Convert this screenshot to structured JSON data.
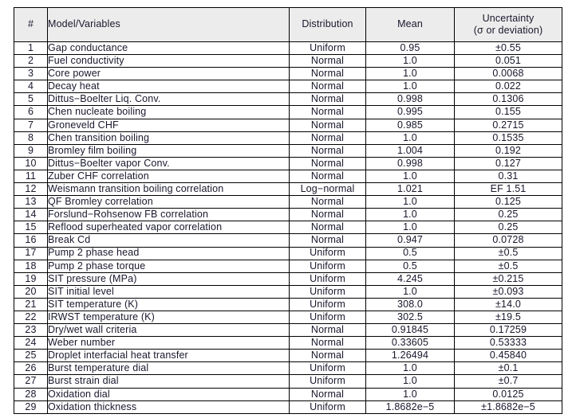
{
  "table": {
    "headers": {
      "number": "#",
      "model": "Model/Variables",
      "distribution": "Distribution",
      "mean": "Mean",
      "uncertainty_line1": "Uncertainty",
      "uncertainty_line2": "(σ or deviation)"
    },
    "colors": {
      "header_background": "#ececec",
      "border": "#000000",
      "text": "#18182c",
      "page_background": "#ffffff"
    },
    "rows": [
      {
        "num": "1",
        "model": "Gap conductance",
        "dist": "Uniform",
        "mean": "0.95",
        "unc": "±0.55"
      },
      {
        "num": "2",
        "model": "Fuel conductivity",
        "dist": "Normal",
        "mean": "1.0",
        "unc": "0.051"
      },
      {
        "num": "3",
        "model": "Core power",
        "dist": "Normal",
        "mean": "1.0",
        "unc": "0.0068"
      },
      {
        "num": "4",
        "model": "Decay heat",
        "dist": "Normal",
        "mean": "1.0",
        "unc": "0.022"
      },
      {
        "num": "5",
        "model": "Dittus−Boelter Liq. Conv.",
        "dist": "Normal",
        "mean": "0.998",
        "unc": "0.1306"
      },
      {
        "num": "6",
        "model": "Chen nucleate boiling",
        "dist": "Normal",
        "mean": "0.995",
        "unc": "0.155"
      },
      {
        "num": "7",
        "model": "Groneveld CHF",
        "dist": "Normal",
        "mean": "0.985",
        "unc": "0.2715"
      },
      {
        "num": "8",
        "model": "Chen transition boiling",
        "dist": "Normal",
        "mean": "1.0",
        "unc": "0.1535"
      },
      {
        "num": "9",
        "model": "Bromley film boiling",
        "dist": "Normal",
        "mean": "1.004",
        "unc": "0.192"
      },
      {
        "num": "10",
        "model": "Dittus−Boelter vapor Conv.",
        "dist": "Normal",
        "mean": "0.998",
        "unc": "0.127"
      },
      {
        "num": "11",
        "model": "Zuber CHF correlation",
        "dist": "Normal",
        "mean": "1.0",
        "unc": "0.31"
      },
      {
        "num": "12",
        "model": "Weismann transition boiling correlation",
        "dist": "Log−normal",
        "mean": "1.021",
        "unc": "EF 1.51"
      },
      {
        "num": "13",
        "model": "QF Bromley correlation",
        "dist": "Normal",
        "mean": "1.0",
        "unc": "0.125"
      },
      {
        "num": "14",
        "model": "Forslund−Rohsenow FB correlation",
        "dist": "Normal",
        "mean": "1.0",
        "unc": "0.25"
      },
      {
        "num": "15",
        "model": "Reflood superheated vapor correlation",
        "dist": "Normal",
        "mean": "1.0",
        "unc": "0.25"
      },
      {
        "num": "16",
        "model": "Break Cd",
        "dist": "Normal",
        "mean": "0.947",
        "unc": "0.0728"
      },
      {
        "num": "17",
        "model": "Pump 2 phase head",
        "dist": "Uniform",
        "mean": "0.5",
        "unc": "±0.5"
      },
      {
        "num": "18",
        "model": "Pump 2 phase torque",
        "dist": "Uniform",
        "mean": "0.5",
        "unc": "±0.5"
      },
      {
        "num": "19",
        "model": "SIT pressure (MPa)",
        "dist": "Uniform",
        "mean": "4.245",
        "unc": "±0.215"
      },
      {
        "num": "20",
        "model": "SIT initial level",
        "dist": "Uniform",
        "mean": "1.0",
        "unc": "±0.093"
      },
      {
        "num": "21",
        "model": "SIT temperature (K)",
        "dist": "Uniform",
        "mean": "308.0",
        "unc": "±14.0"
      },
      {
        "num": "22",
        "model": "IRWST temperature (K)",
        "dist": "Uniform",
        "mean": "302.5",
        "unc": "±19.5"
      },
      {
        "num": "23",
        "model": "Dry/wet wall criteria",
        "dist": "Normal",
        "mean": "0.91845",
        "unc": "0.17259"
      },
      {
        "num": "24",
        "model": "Weber number",
        "dist": "Normal",
        "mean": "0.33605",
        "unc": "0.53333"
      },
      {
        "num": "25",
        "model": "Droplet interfacial heat transfer",
        "dist": "Normal",
        "mean": "1.26494",
        "unc": "0.45840"
      },
      {
        "num": "26",
        "model": "Burst temperature dial",
        "dist": "Uniform",
        "mean": "1.0",
        "unc": "±0.1"
      },
      {
        "num": "27",
        "model": "Burst strain dial",
        "dist": "Uniform",
        "mean": "1.0",
        "unc": "±0.7"
      },
      {
        "num": "28",
        "model": "Oxidation dial",
        "dist": "Normal",
        "mean": "1.0",
        "unc": "0.0125"
      },
      {
        "num": "29",
        "model": "Oxidation thickness",
        "dist": "Uniform",
        "mean": "1.8682e−5",
        "unc": "±1.8682e−5"
      }
    ]
  }
}
